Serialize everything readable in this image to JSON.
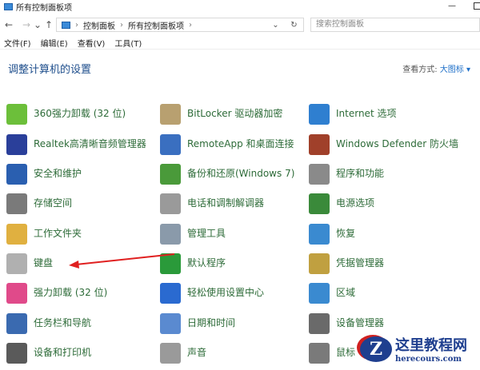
{
  "window": {
    "title": "所有控制面板项"
  },
  "address": {
    "crumbs": [
      "控制面板",
      "所有控制面板项"
    ],
    "search_placeholder": "搜索控制面板"
  },
  "nav": {
    "back": "←",
    "forward": "→",
    "recent": "⌄",
    "up": "↑",
    "dropdown": "⌄",
    "refresh": "↻"
  },
  "menu": [
    "文件(F)",
    "编辑(E)",
    "查看(V)",
    "工具(T)"
  ],
  "heading": "调整计算机的设置",
  "view": {
    "label": "查看方式:",
    "value": "大图标 ▾"
  },
  "items": [
    {
      "label": "360强力卸载 (32 位)",
      "icon": "uninstall-icon",
      "color": "#6cbf3a"
    },
    {
      "label": "BitLocker 驱动器加密",
      "icon": "bitlocker-icon",
      "color": "#b8a070"
    },
    {
      "label": "Internet 选项",
      "icon": "internet-icon",
      "color": "#2f7fd0"
    },
    {
      "label": "Realtek高清晰音频管理器",
      "icon": "realtek-icon",
      "color": "#2a3f9a"
    },
    {
      "label": "RemoteApp 和桌面连接",
      "icon": "remoteapp-icon",
      "color": "#3a6fc0"
    },
    {
      "label": "Windows Defender 防火墙",
      "icon": "firewall-icon",
      "color": "#a0402a"
    },
    {
      "label": "安全和维护",
      "icon": "flag-icon",
      "color": "#2a5fb0"
    },
    {
      "label": "备份和还原(Windows 7)",
      "icon": "backup-icon",
      "color": "#4a9a3a"
    },
    {
      "label": "程序和功能",
      "icon": "programs-icon",
      "color": "#8a8a8a"
    },
    {
      "label": "存储空间",
      "icon": "storage-icon",
      "color": "#7a7a7a"
    },
    {
      "label": "电话和调制解调器",
      "icon": "phone-icon",
      "color": "#9a9a9a"
    },
    {
      "label": "电源选项",
      "icon": "power-icon",
      "color": "#3a8a3a"
    },
    {
      "label": "工作文件夹",
      "icon": "folder-icon",
      "color": "#e0b040"
    },
    {
      "label": "管理工具",
      "icon": "admin-tools-icon",
      "color": "#8a9aaa"
    },
    {
      "label": "恢复",
      "icon": "recovery-icon",
      "color": "#3a8ad0"
    },
    {
      "label": "键盘",
      "icon": "keyboard-icon",
      "color": "#b0b0b0"
    },
    {
      "label": "默认程序",
      "icon": "default-programs-icon",
      "color": "#2a9a3a"
    },
    {
      "label": "凭据管理器",
      "icon": "credential-icon",
      "color": "#c0a040"
    },
    {
      "label": "强力卸载 (32 位)",
      "icon": "uninstall2-icon",
      "color": "#e04a8a"
    },
    {
      "label": "轻松使用设置中心",
      "icon": "ease-of-access-icon",
      "color": "#2a6ad0"
    },
    {
      "label": "区域",
      "icon": "region-icon",
      "color": "#3a8ad0"
    },
    {
      "label": "任务栏和导航",
      "icon": "taskbar-icon",
      "color": "#3a6ab0"
    },
    {
      "label": "日期和时间",
      "icon": "datetime-icon",
      "color": "#5a8ad0"
    },
    {
      "label": "设备管理器",
      "icon": "device-manager-icon",
      "color": "#6a6a6a"
    },
    {
      "label": "设备和打印机",
      "icon": "printer-icon",
      "color": "#5a5a5a"
    },
    {
      "label": "声音",
      "icon": "sound-icon",
      "color": "#9a9a9a"
    },
    {
      "label": "鼠标",
      "icon": "mouse-icon",
      "color": "#7a7a7a"
    }
  ],
  "watermark": {
    "title": "这里教程网",
    "url": "herecours.com",
    "letter": "Z"
  }
}
